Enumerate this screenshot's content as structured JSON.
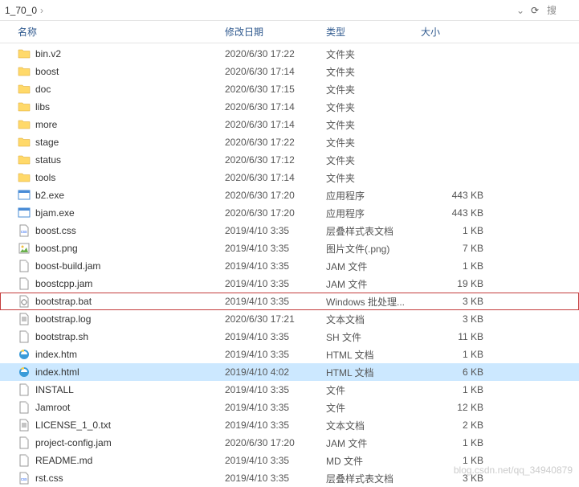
{
  "topbar": {
    "path": "1_70_0",
    "refresh_tip": "刷新",
    "search_placeholder": "搜"
  },
  "header": {
    "name": "名称",
    "date": "修改日期",
    "type": "类型",
    "size": "大小"
  },
  "files": [
    {
      "icon": "folder",
      "name": "bin.v2",
      "date": "2020/6/30 17:22",
      "type": "文件夹",
      "size": ""
    },
    {
      "icon": "folder",
      "name": "boost",
      "date": "2020/6/30 17:14",
      "type": "文件夹",
      "size": ""
    },
    {
      "icon": "folder",
      "name": "doc",
      "date": "2020/6/30 17:15",
      "type": "文件夹",
      "size": ""
    },
    {
      "icon": "folder",
      "name": "libs",
      "date": "2020/6/30 17:14",
      "type": "文件夹",
      "size": ""
    },
    {
      "icon": "folder",
      "name": "more",
      "date": "2020/6/30 17:14",
      "type": "文件夹",
      "size": ""
    },
    {
      "icon": "folder",
      "name": "stage",
      "date": "2020/6/30 17:22",
      "type": "文件夹",
      "size": ""
    },
    {
      "icon": "folder",
      "name": "status",
      "date": "2020/6/30 17:12",
      "type": "文件夹",
      "size": ""
    },
    {
      "icon": "folder",
      "name": "tools",
      "date": "2020/6/30 17:14",
      "type": "文件夹",
      "size": ""
    },
    {
      "icon": "exe",
      "name": "b2.exe",
      "date": "2020/6/30 17:20",
      "type": "应用程序",
      "size": "443 KB"
    },
    {
      "icon": "exe",
      "name": "bjam.exe",
      "date": "2020/6/30 17:20",
      "type": "应用程序",
      "size": "443 KB"
    },
    {
      "icon": "css",
      "name": "boost.css",
      "date": "2019/4/10 3:35",
      "type": "层叠样式表文档",
      "size": "1 KB"
    },
    {
      "icon": "png",
      "name": "boost.png",
      "date": "2019/4/10 3:35",
      "type": "图片文件(.png)",
      "size": "7 KB"
    },
    {
      "icon": "file",
      "name": "boost-build.jam",
      "date": "2019/4/10 3:35",
      "type": "JAM 文件",
      "size": "1 KB"
    },
    {
      "icon": "file",
      "name": "boostcpp.jam",
      "date": "2019/4/10 3:35",
      "type": "JAM 文件",
      "size": "19 KB"
    },
    {
      "icon": "bat",
      "name": "bootstrap.bat",
      "date": "2019/4/10 3:35",
      "type": "Windows 批处理...",
      "size": "3 KB",
      "highlighted": true
    },
    {
      "icon": "txt",
      "name": "bootstrap.log",
      "date": "2020/6/30 17:21",
      "type": "文本文档",
      "size": "3 KB"
    },
    {
      "icon": "file",
      "name": "bootstrap.sh",
      "date": "2019/4/10 3:35",
      "type": "SH 文件",
      "size": "11 KB"
    },
    {
      "icon": "ie",
      "name": "index.htm",
      "date": "2019/4/10 3:35",
      "type": "HTML 文档",
      "size": "1 KB"
    },
    {
      "icon": "ie",
      "name": "index.html",
      "date": "2019/4/10 4:02",
      "type": "HTML 文档",
      "size": "6 KB",
      "selected": true
    },
    {
      "icon": "file",
      "name": "INSTALL",
      "date": "2019/4/10 3:35",
      "type": "文件",
      "size": "1 KB"
    },
    {
      "icon": "file",
      "name": "Jamroot",
      "date": "2019/4/10 3:35",
      "type": "文件",
      "size": "12 KB"
    },
    {
      "icon": "txt",
      "name": "LICENSE_1_0.txt",
      "date": "2019/4/10 3:35",
      "type": "文本文档",
      "size": "2 KB"
    },
    {
      "icon": "file",
      "name": "project-config.jam",
      "date": "2020/6/30 17:20",
      "type": "JAM 文件",
      "size": "1 KB"
    },
    {
      "icon": "file",
      "name": "README.md",
      "date": "2019/4/10 3:35",
      "type": "MD 文件",
      "size": "1 KB"
    },
    {
      "icon": "css",
      "name": "rst.css",
      "date": "2019/4/10 3:35",
      "type": "层叠样式表文档",
      "size": "3 KB"
    }
  ],
  "watermark": "blog.csdn.net/qq_34940879"
}
